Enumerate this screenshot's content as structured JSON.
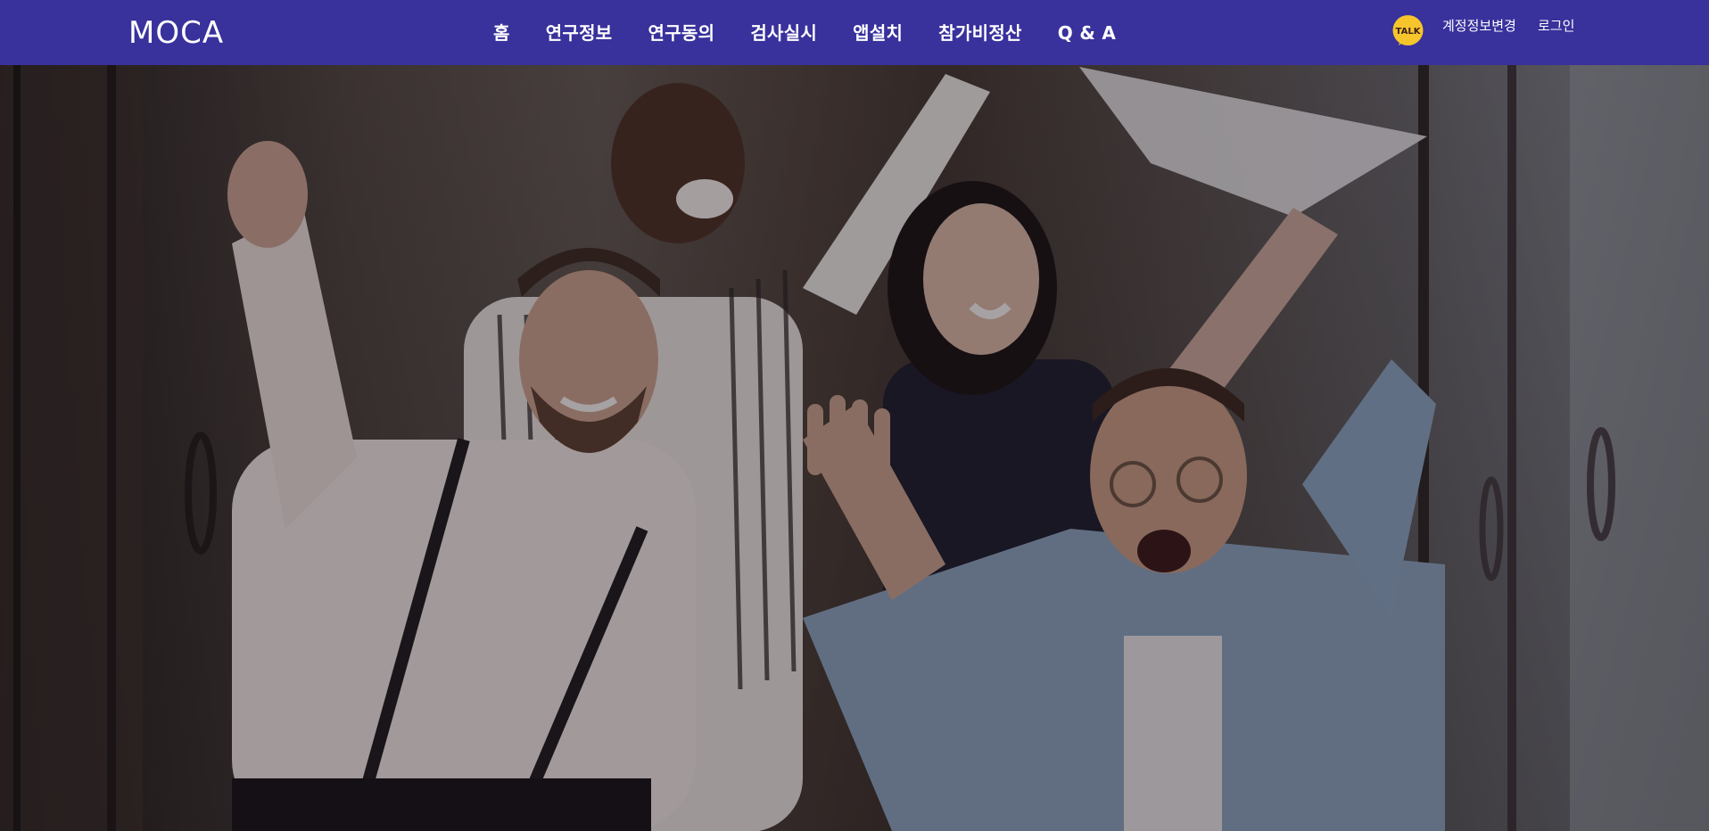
{
  "brand": {
    "name": "MOCA"
  },
  "nav": {
    "items": [
      {
        "label": "홈"
      },
      {
        "label": "연구정보"
      },
      {
        "label": "연구동의"
      },
      {
        "label": "검사실시"
      },
      {
        "label": "앱설치"
      },
      {
        "label": "참가비정산"
      },
      {
        "label": "Q & A"
      }
    ]
  },
  "top_links": {
    "talk_badge": "TALK",
    "account_change": "계정정보변경",
    "login": "로그인"
  },
  "colors": {
    "header_bg": "#39319c",
    "talk_yellow": "#f6c52b",
    "talk_brown": "#3b1e1e"
  },
  "hero": {
    "image": "group-celebrating-photo"
  }
}
